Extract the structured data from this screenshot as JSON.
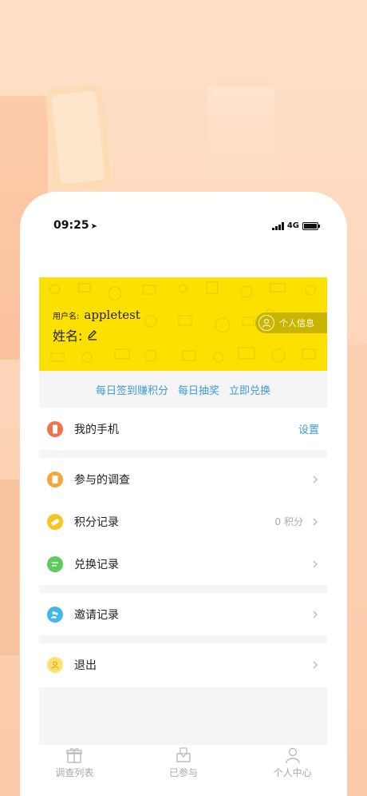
{
  "status_bar": {
    "time": "09:25",
    "network": "4G"
  },
  "profile": {
    "username_label": "用户名:",
    "username_value": "appletest",
    "name_label": "姓名:",
    "info_button": "个人信息"
  },
  "links": [
    "每日签到赚积分",
    "每日抽奖",
    "立即兑换"
  ],
  "menu": {
    "phone": {
      "label": "我的手机",
      "action": "设置"
    },
    "surveys": {
      "label": "参与的调查"
    },
    "points": {
      "label": "积分记录",
      "value": "0 积分"
    },
    "exchange": {
      "label": "兑换记录"
    },
    "invite": {
      "label": "邀请记录"
    },
    "logout": {
      "label": "退出"
    }
  },
  "tabs": [
    {
      "label": "调查列表",
      "icon": "gift-icon"
    },
    {
      "label": "已参与",
      "icon": "inbox-icon"
    },
    {
      "label": "个人中心",
      "icon": "person-icon"
    }
  ],
  "colors": {
    "accent_yellow": "#fce100",
    "link_blue": "#3e9ad8",
    "phone_icon": "#f3734a",
    "survey_icon": "#f7a63a",
    "points_icon": "#f9c51c",
    "exchange_icon": "#5ccc5c",
    "invite_icon": "#45b6ea",
    "logout_icon": "#ffe070"
  }
}
